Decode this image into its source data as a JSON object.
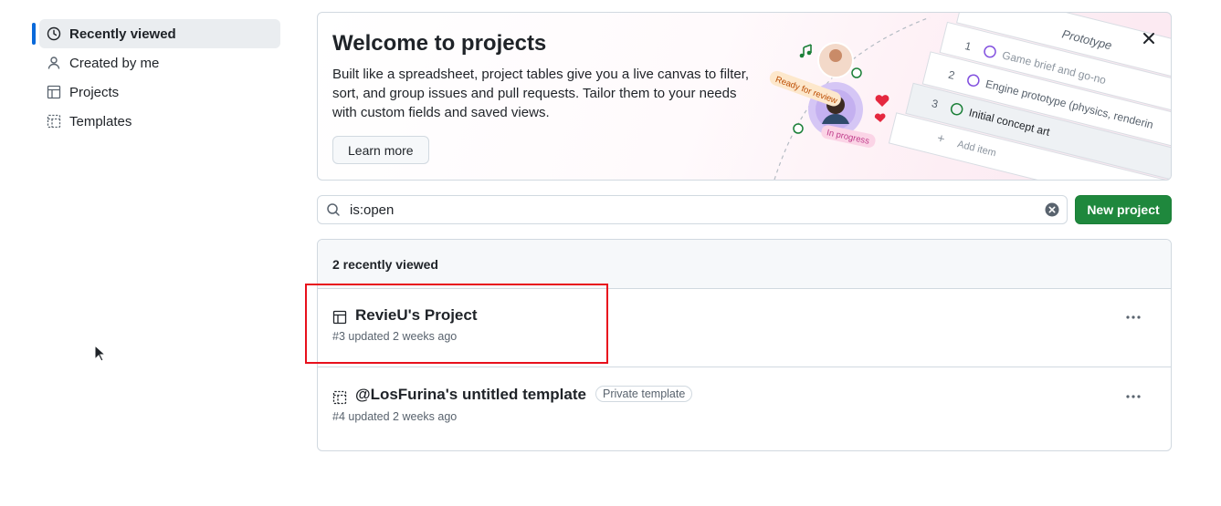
{
  "sidebar": {
    "items": [
      {
        "label": "Recently viewed",
        "icon": "clock-icon",
        "active": true
      },
      {
        "label": "Created by me",
        "icon": "person-icon",
        "active": false
      },
      {
        "label": "Projects",
        "icon": "table-icon",
        "active": false
      },
      {
        "label": "Templates",
        "icon": "template-icon",
        "active": false
      }
    ]
  },
  "banner": {
    "title": "Welcome to projects",
    "description": "Built like a spreadsheet, project tables give you a live canvas to filter, sort, and group issues and pull requests. Tailor them to your needs with custom fields and saved views.",
    "learn_more": "Learn more",
    "illustration": {
      "ready_tag": "Ready for review",
      "progress_tag": "In progress",
      "group": "Prototype",
      "rows": [
        {
          "num": "1",
          "text": "Game brief and go-no"
        },
        {
          "num": "2",
          "text": "Engine prototype (physics, renderin"
        },
        {
          "num": "3",
          "text": "Initial concept art"
        }
      ],
      "add_item": "Add item"
    }
  },
  "search": {
    "value": "is:open"
  },
  "new_project_label": "New project",
  "list": {
    "header": "2 recently viewed",
    "rows": [
      {
        "title": "RevieU's Project",
        "meta": "#3 updated 2 weeks ago",
        "icon": "table-icon",
        "badge": ""
      },
      {
        "title": "@LosFurina's untitled template",
        "meta": "#4 updated 2 weeks ago",
        "icon": "template-icon",
        "badge": "Private template"
      }
    ]
  },
  "colors": {
    "accent": "#0969da",
    "primary_button": "#1f883d",
    "highlight": "#e8101c"
  }
}
